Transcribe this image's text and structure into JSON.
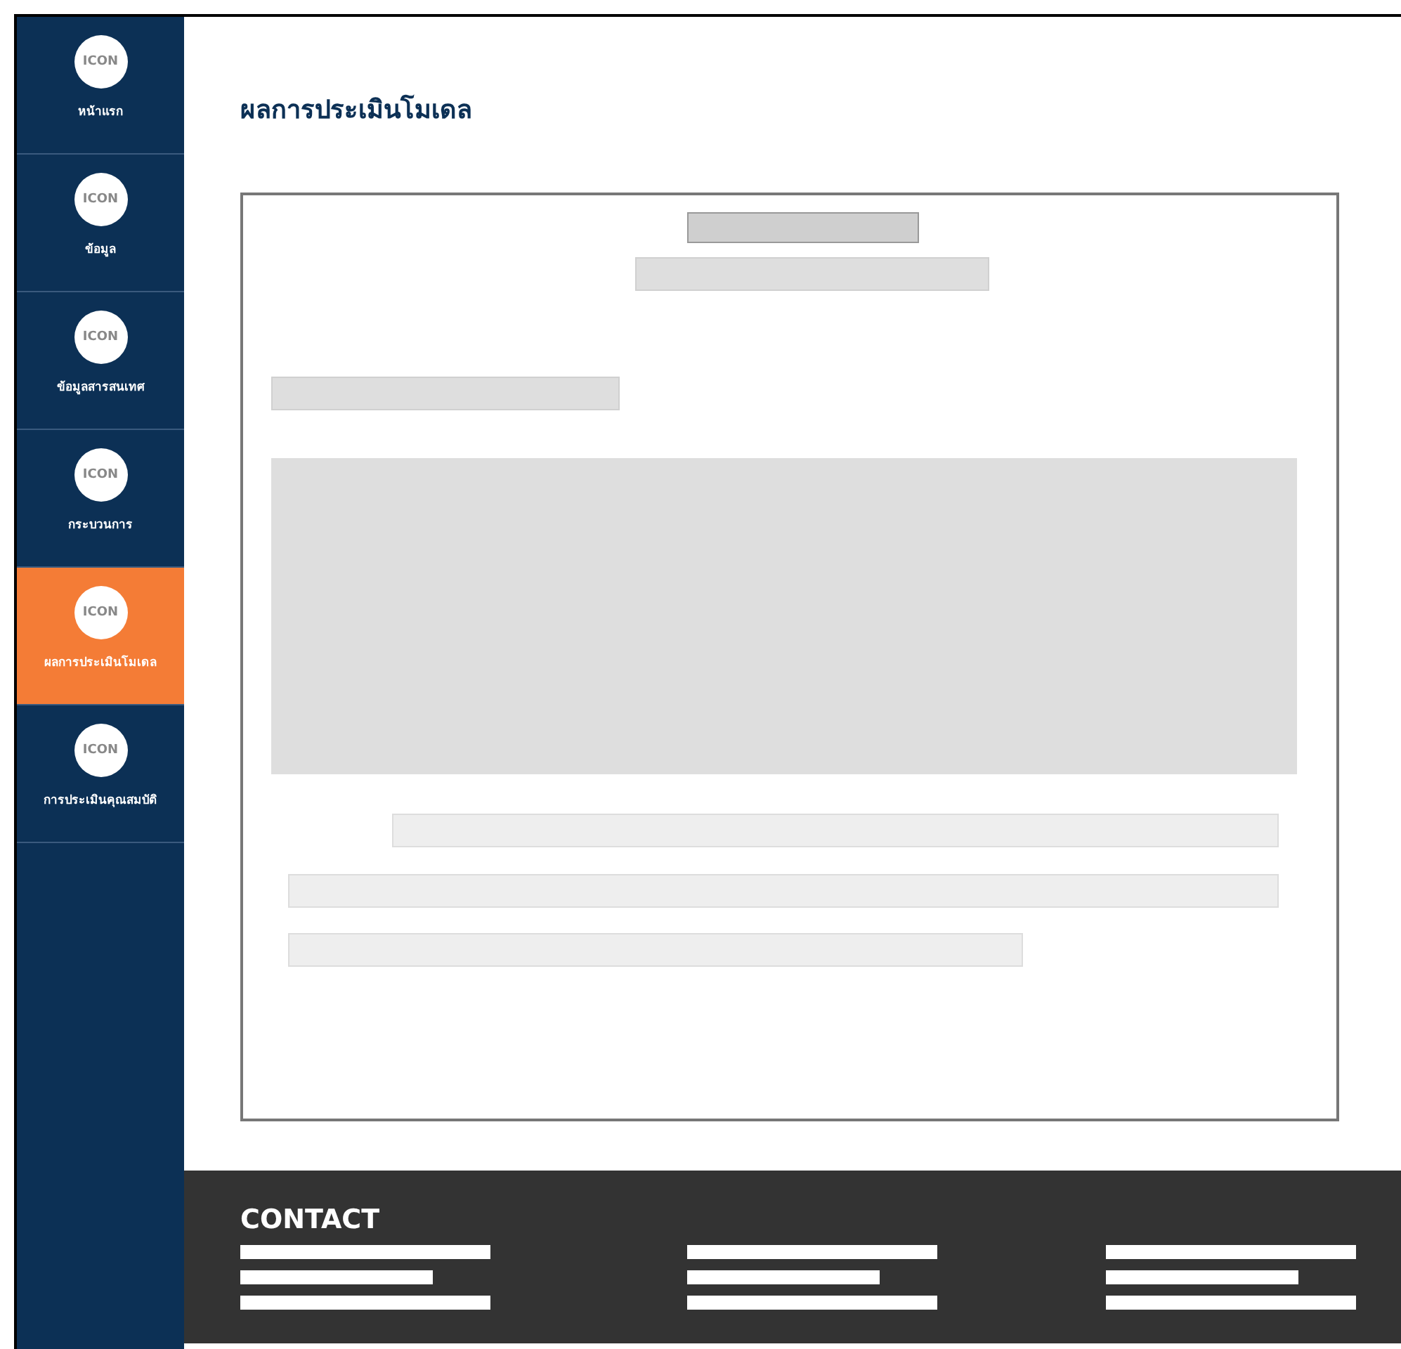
{
  "sidebar": {
    "items": [
      {
        "icon_text": "ICON",
        "label": "หน้าแรก",
        "selected": false
      },
      {
        "icon_text": "ICON",
        "label": "ข้อมูล",
        "selected": false
      },
      {
        "icon_text": "ICON",
        "label": "ข้อมูลสารสนเทศ",
        "selected": false
      },
      {
        "icon_text": "ICON",
        "label": "กระบวนการ",
        "selected": false
      },
      {
        "icon_text": "ICON",
        "label": "ผลการประเมินโมเดล",
        "selected": true
      },
      {
        "icon_text": "ICON",
        "label": "การประเมินคุณสมบัติ",
        "selected": false
      }
    ]
  },
  "page": {
    "title": "ผลการประเมินโมเดล"
  },
  "footer": {
    "heading": "CONTACT"
  }
}
